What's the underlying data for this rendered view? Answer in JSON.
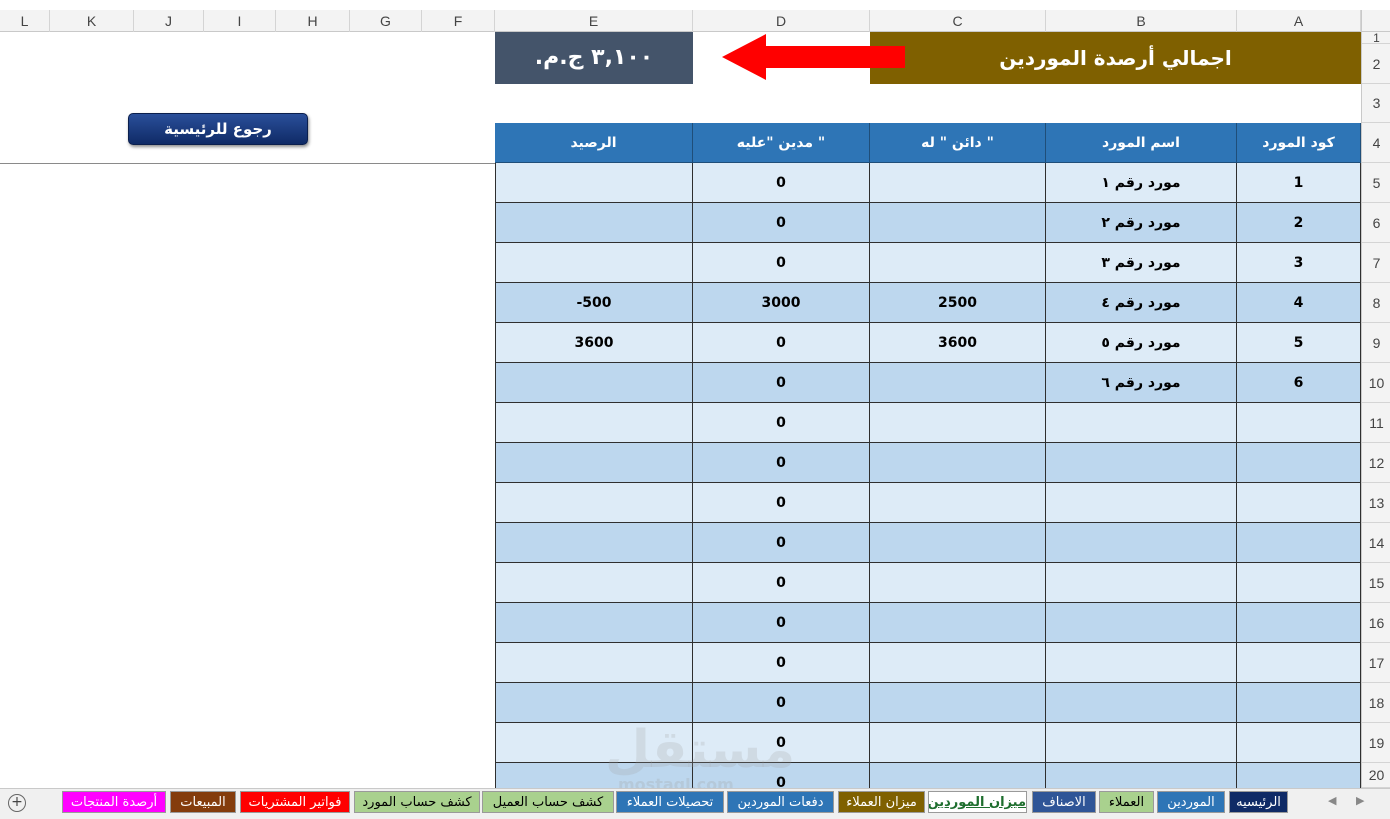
{
  "columns": [
    "L",
    "K",
    "J",
    "I",
    "H",
    "G",
    "F",
    "E",
    "D",
    "C",
    "B",
    "A"
  ],
  "rows": [
    "1",
    "2",
    "3",
    "4",
    "5",
    "6",
    "7",
    "8",
    "9",
    "10",
    "11",
    "12",
    "13",
    "14",
    "15",
    "16",
    "17",
    "18",
    "19",
    "20"
  ],
  "title": "اجمالي أرصدة الموردين",
  "total": "٣,١٠٠ ج.م.",
  "home_button": "رجوع للرئيسية",
  "table": {
    "headers": [
      "كود المورد",
      "اسم المورد",
      "دائن \" له \"",
      "مدين \"عليه \"",
      "الرصيد"
    ],
    "rows": [
      [
        "1",
        "مورد رقم ١",
        "",
        "0",
        ""
      ],
      [
        "2",
        "مورد رقم ٢",
        "",
        "0",
        ""
      ],
      [
        "3",
        "مورد رقم ٣",
        "",
        "0",
        ""
      ],
      [
        "4",
        "مورد رقم ٤",
        "2500",
        "3000",
        "-500"
      ],
      [
        "5",
        "مورد رقم ٥",
        "3600",
        "0",
        "3600"
      ],
      [
        "6",
        "مورد رقم ٦",
        "",
        "0",
        ""
      ],
      [
        "",
        "",
        "",
        "0",
        ""
      ],
      [
        "",
        "",
        "",
        "0",
        ""
      ],
      [
        "",
        "",
        "",
        "0",
        ""
      ],
      [
        "",
        "",
        "",
        "0",
        ""
      ],
      [
        "",
        "",
        "",
        "0",
        ""
      ],
      [
        "",
        "",
        "",
        "0",
        ""
      ],
      [
        "",
        "",
        "",
        "0",
        ""
      ],
      [
        "",
        "",
        "",
        "0",
        ""
      ],
      [
        "",
        "",
        "",
        "0",
        ""
      ],
      [
        "",
        "",
        "",
        "0",
        ""
      ]
    ]
  },
  "tabs": [
    {
      "label": "الرئيسيه",
      "bg": "#0f2a66",
      "fg": "#ffffff"
    },
    {
      "label": "الموردين",
      "bg": "#2e75b6",
      "fg": "#ffffff"
    },
    {
      "label": "العملاء",
      "bg": "#a9d18e",
      "fg": "#000000"
    },
    {
      "label": "الاصناف",
      "bg": "#2f5597",
      "fg": "#ffffff"
    },
    {
      "label": "ميزان الموردين",
      "bg": "#ffffff",
      "fg": "#1e6e2e",
      "active": true
    },
    {
      "label": "ميزان العملاء",
      "bg": "#7f6000",
      "fg": "#ffffff"
    },
    {
      "label": "دفعات الموردين",
      "bg": "#2e75b6",
      "fg": "#ffffff"
    },
    {
      "label": "تحصيلات العملاء",
      "bg": "#2e75b6",
      "fg": "#ffffff"
    },
    {
      "label": "كشف حساب العميل",
      "bg": "#a9d18e",
      "fg": "#000000"
    },
    {
      "label": "كشف حساب المورد",
      "bg": "#a9d18e",
      "fg": "#000000"
    },
    {
      "label": "فواتير المشتريات",
      "bg": "#ff0000",
      "fg": "#ffffff"
    },
    {
      "label": "المبيعات",
      "bg": "#843c0c",
      "fg": "#ffffff"
    },
    {
      "label": "أرصدة المنتجات",
      "bg": "#ff00ff",
      "fg": "#ffffff"
    }
  ],
  "colors": {
    "title_bg": "#7f6000",
    "total_bg": "#44546a",
    "header_bg": "#2e75b6",
    "row_light": "#ddebf7",
    "row_dark": "#bdd7ee",
    "arrow": "#ff0000"
  },
  "icons": {
    "add_sheet": "plus-circle-icon",
    "arrow": "left-arrow-icon"
  }
}
